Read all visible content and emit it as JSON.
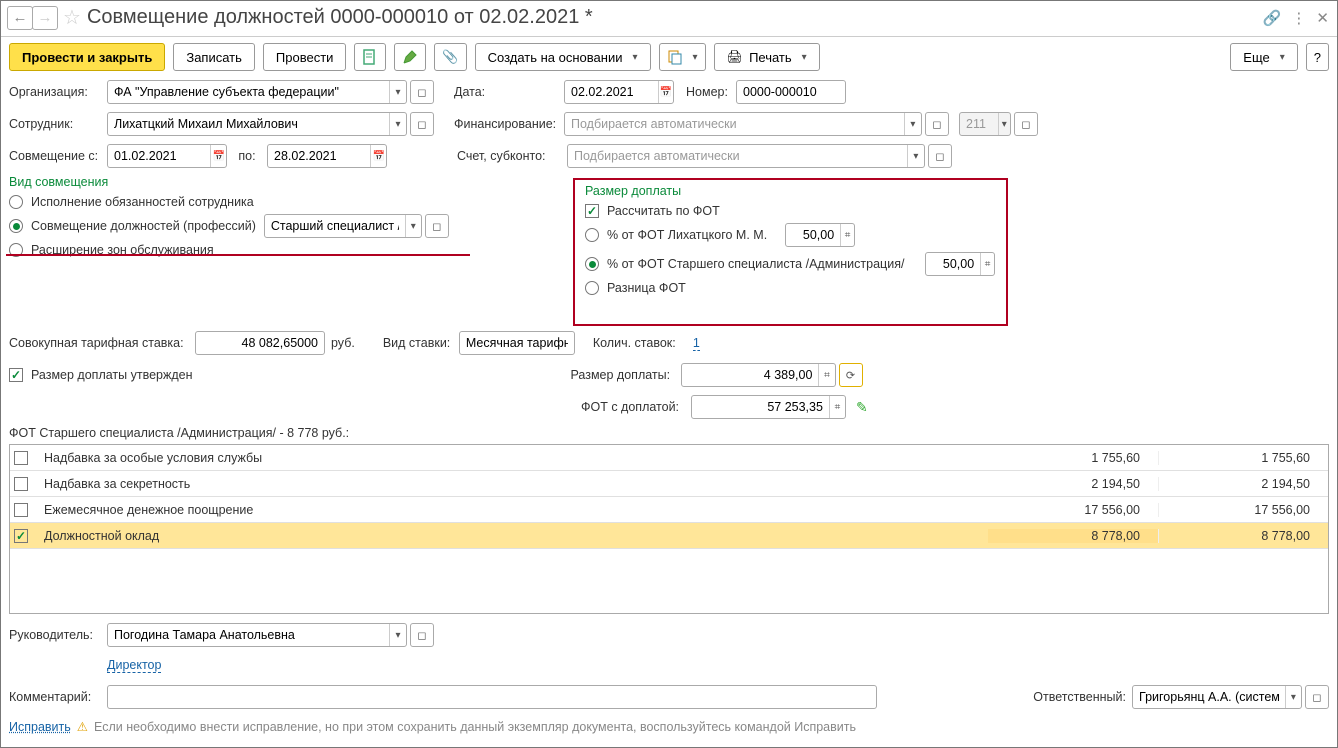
{
  "title": "Совмещение должностей 0000-000010 от 02.02.2021 *",
  "toolbar": {
    "post_close": "Провести и закрыть",
    "save": "Записать",
    "post": "Провести",
    "create_based": "Создать на основании",
    "print": "Печать",
    "more": "Еще"
  },
  "labels": {
    "org": "Организация:",
    "date": "Дата:",
    "number": "Номер:",
    "employee": "Сотрудник:",
    "financing": "Финансирование:",
    "combine_from": "Совмещение с:",
    "to": "по:",
    "account": "Счет, субконто:",
    "combine_type": "Вид совмещения",
    "payment_size": "Размер доплаты",
    "aggregate_rate": "Совокупная тарифная ставка:",
    "rub": "руб.",
    "rate_type": "Вид ставки:",
    "rate_count": "Колич. ставок:",
    "approved": "Размер доплаты утвержден",
    "payment_amount": "Размер доплаты:",
    "fot_total": "ФОТ с доплатой:",
    "table_header": "ФОТ Старшего специалиста /Администрация/ - 8 778 руб.:",
    "manager": "Руководитель:",
    "manager_title": "Директор",
    "comment": "Комментарий:",
    "responsible": "Ответственный:",
    "fix": "Исправить",
    "fix_note": "Если необходимо внести исправление, но при этом сохранить данный экземпляр документа, воспользуйтесь командой Исправить"
  },
  "values": {
    "org": "ФА \"Управление субъекта федерации\"",
    "date": "02.02.2021",
    "number": "0000-000010",
    "employee": "Лихатцкий Михаил Михайлович",
    "financing_ph": "Подбирается автоматически",
    "fin_code": "211",
    "date_from": "01.02.2021",
    "date_to": "28.02.2021",
    "account_ph": "Подбирается автоматически",
    "position": "Старший специалист /Адм",
    "aggregate_rate": "48 082,65000",
    "rate_type": "Месячная тарифн",
    "rate_count": "1",
    "payment_amount": "4 389,00",
    "fot_total": "57 253,35",
    "pct1_label": "% от ФОТ Лихатцкого М. М.",
    "pct1_val": "50,00",
    "pct2_label": "% от ФОТ Старшего специалиста /Администрация/",
    "pct2_val": "50,00",
    "manager": "Погодина Тамара Анатольевна",
    "responsible": "Григорьянц А.А. (системн"
  },
  "radios": {
    "duties": "Исполнение обязанностей сотрудника",
    "combine": "Совмещение должностей (профессий)",
    "expand": "Расширение зон обслуживания",
    "calc_fot": "Рассчитать по ФОТ",
    "diff": "Разница ФОТ"
  },
  "table": [
    {
      "checked": false,
      "name": "Надбавка за особые условия службы",
      "v1": "1 755,60",
      "v2": "1 755,60"
    },
    {
      "checked": false,
      "name": "Надбавка за секретность",
      "v1": "2 194,50",
      "v2": "2 194,50"
    },
    {
      "checked": false,
      "name": "Ежемесячное денежное поощрение",
      "v1": "17 556,00",
      "v2": "17 556,00"
    },
    {
      "checked": true,
      "name": "Должностной оклад",
      "v1": "8 778,00",
      "v2": "8 778,00",
      "selected": true
    }
  ]
}
